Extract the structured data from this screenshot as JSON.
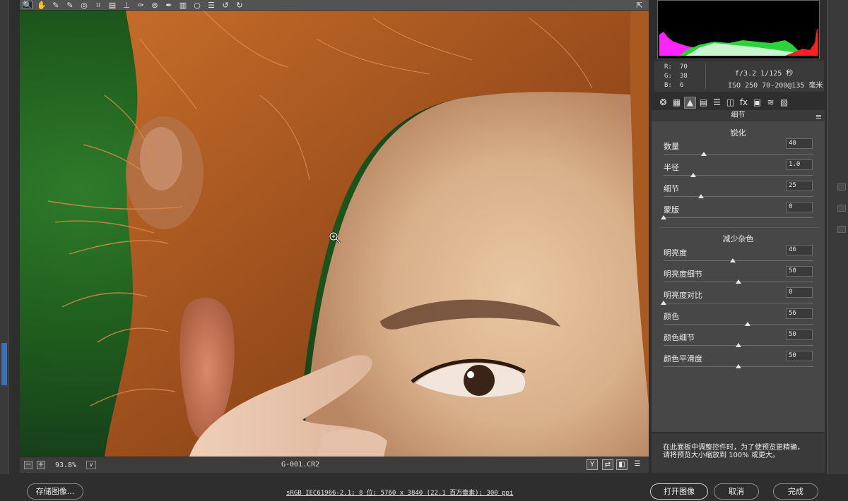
{
  "toolbar": {
    "tools": [
      {
        "name": "zoom-tool-icon",
        "glyph": "🔍"
      },
      {
        "name": "hand-tool-icon",
        "glyph": "✋"
      },
      {
        "name": "white-balance-icon",
        "glyph": "✎"
      },
      {
        "name": "color-sampler-icon",
        "glyph": "✎"
      },
      {
        "name": "target-adjust-icon",
        "glyph": "◎"
      },
      {
        "name": "crop-tool-icon",
        "glyph": "⌗"
      },
      {
        "name": "straighten-icon",
        "glyph": "▤"
      },
      {
        "name": "transform-icon",
        "glyph": "⊥"
      },
      {
        "name": "spot-removal-icon",
        "glyph": "✑"
      },
      {
        "name": "red-eye-icon",
        "glyph": "⊚"
      },
      {
        "name": "adjust-brush-icon",
        "glyph": "✒"
      },
      {
        "name": "graduated-filter-icon",
        "glyph": "▥"
      },
      {
        "name": "radial-filter-icon",
        "glyph": "○"
      },
      {
        "name": "preferences-icon",
        "glyph": "☰"
      },
      {
        "name": "rotate-left-icon",
        "glyph": "↺"
      },
      {
        "name": "rotate-right-icon",
        "glyph": "↻"
      }
    ],
    "fullscreen_glyph": "⇱"
  },
  "info": {
    "r_label": "R:",
    "r_value": "70",
    "g_label": "G:",
    "g_value": "38",
    "b_label": "B:",
    "b_value": "6",
    "aperture_shutter": "f/3.2  1/125 秒",
    "iso_lens": "ISO 250  70-200@135 毫米"
  },
  "panel": {
    "header": "细节",
    "menu_glyph": "≡",
    "sharpen_title": "锐化",
    "noise_title": "减少杂色",
    "sharpen": [
      {
        "label": "数量",
        "value": "40",
        "pos": 0.27
      },
      {
        "label": "半径",
        "value": "1.0",
        "pos": 0.2
      },
      {
        "label": "细节",
        "value": "25",
        "pos": 0.25
      },
      {
        "label": "蒙版",
        "value": "0",
        "pos": 0.0
      }
    ],
    "noise": [
      {
        "label": "明亮度",
        "value": "46",
        "pos": 0.46
      },
      {
        "label": "明亮度细节",
        "value": "50",
        "pos": 0.5
      },
      {
        "label": "明亮度对比",
        "value": "0",
        "pos": 0.0
      },
      {
        "label": "颜色",
        "value": "56",
        "pos": 0.56
      },
      {
        "label": "颜色细节",
        "value": "50",
        "pos": 0.5
      },
      {
        "label": "颜色平滑度",
        "value": "50",
        "pos": 0.5
      }
    ],
    "tabs": [
      {
        "name": "basic-tab-icon",
        "glyph": "❂"
      },
      {
        "name": "tone-curve-tab-icon",
        "glyph": "▦"
      },
      {
        "name": "detail-tab-icon",
        "glyph": "▲"
      },
      {
        "name": "hsl-tab-icon",
        "glyph": "▤"
      },
      {
        "name": "split-toning-tab-icon",
        "glyph": "☰"
      },
      {
        "name": "lens-tab-icon",
        "glyph": "◫"
      },
      {
        "name": "effects-tab-icon",
        "glyph": "fx"
      },
      {
        "name": "camera-calibration-tab-icon",
        "glyph": "▣"
      },
      {
        "name": "presets-tab-icon",
        "glyph": "≋"
      },
      {
        "name": "snapshots-tab-icon",
        "glyph": "▧"
      }
    ]
  },
  "hint": {
    "line1": "在此面板中调整控件时，为了使预览更精确，",
    "line2": "请将预览大小缩放到 100% 或更大。"
  },
  "status": {
    "zoom_minus": "−",
    "zoom_plus": "+",
    "zoom": "93.8%",
    "zoom_dropdown": "∨",
    "filename": "G-001.CR2",
    "view_y": "Y",
    "view_before_after": "⇄",
    "view_toggle": "◧",
    "view_prefs": "☰"
  },
  "bottom": {
    "save_label": "存储图像...",
    "workflow": "sRGB IEC61966-2.1; 8 位; 5760 x 3840 (22.1 百万像素); 300 ppi",
    "open_label": "打开图像",
    "cancel_label": "取消",
    "done_label": "完成"
  },
  "colors": {
    "panel_bg": "#474747",
    "histogram_red": "#ff2020",
    "histogram_green": "#2cd23a",
    "histogram_magenta": "#ff25ff",
    "histogram_blue": "#3b3bff"
  }
}
